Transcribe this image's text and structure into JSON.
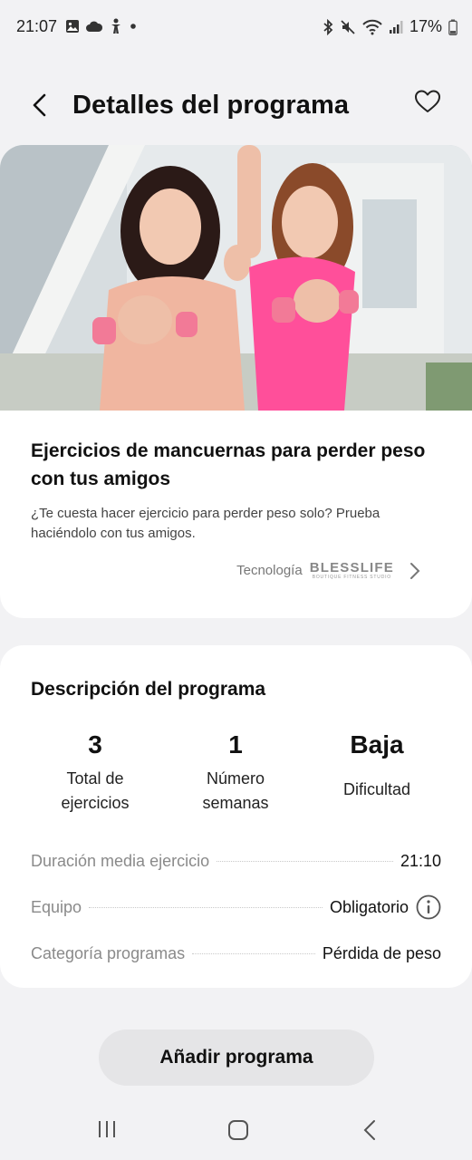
{
  "status_bar": {
    "time": "21:07",
    "battery": "17%"
  },
  "header": {
    "title": "Detalles del programa"
  },
  "program": {
    "title": "Ejercicios de mancuernas para perder peso con tus amigos",
    "description": "¿Te cuesta hacer ejercicio para perder peso solo? Prueba haciéndolo con tus amigos.",
    "tech_label": "Tecnología",
    "brand": "BLESSLIFE",
    "brand_sub": "BOUTIQUE FITNESS STUDIO"
  },
  "description_section": {
    "title": "Descripción del programa",
    "stats": [
      {
        "value": "3",
        "label": "Total de ejercicios"
      },
      {
        "value": "1",
        "label": "Número semanas"
      },
      {
        "value": "Baja",
        "label": "Dificultad"
      }
    ],
    "rows": [
      {
        "key": "Duración media ejercicio",
        "value": "21:10"
      },
      {
        "key": "Equipo",
        "value": "Obligatorio"
      },
      {
        "key": "Categoría programas",
        "value": "Pérdida de peso"
      }
    ]
  },
  "actions": {
    "add_label": "Añadir programa"
  },
  "colors": {
    "hero_pink": "#ff4f9a",
    "dumbbell_pink": "#f27a97",
    "button_bg": "#e5e5e7"
  }
}
